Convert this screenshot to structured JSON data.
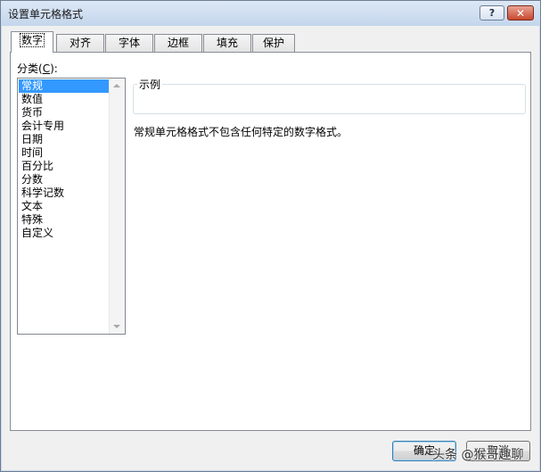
{
  "window": {
    "title": "设置单元格格式",
    "help_label": "?",
    "close_label": "✕"
  },
  "tabs": [
    {
      "label": "数字",
      "active": true
    },
    {
      "label": "对齐"
    },
    {
      "label": "字体"
    },
    {
      "label": "边框"
    },
    {
      "label": "填充"
    },
    {
      "label": "保护"
    }
  ],
  "category": {
    "label_prefix": "分类(",
    "label_accel": "C",
    "label_suffix": "):",
    "items": [
      "常规",
      "数值",
      "货币",
      "会计专用",
      "日期",
      "时间",
      "百分比",
      "分数",
      "科学记数",
      "文本",
      "特殊",
      "自定义"
    ],
    "selected": "常规"
  },
  "sample": {
    "legend": "示例",
    "value": ""
  },
  "description": "常规单元格格式不包含任何特定的数字格式。",
  "buttons": {
    "ok_label": "确定",
    "cancel_label": "取消"
  },
  "watermark": "头条 @猴哥趣聊"
}
